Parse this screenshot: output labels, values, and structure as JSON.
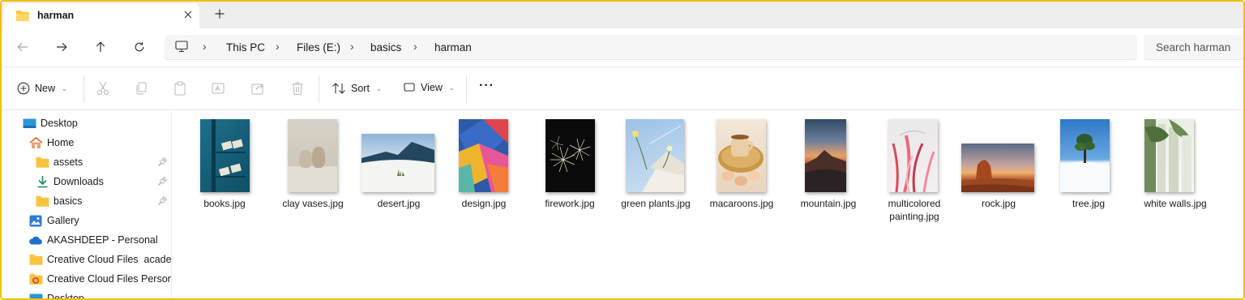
{
  "tab": {
    "title": "harman",
    "close_icon": "close-icon",
    "new_tab_icon": "plus-icon"
  },
  "breadcrumb": [
    "This PC",
    "Files (E:)",
    "basics",
    "harman"
  ],
  "search": {
    "placeholder": "Search harman"
  },
  "toolbar": {
    "new_label": "New",
    "sort_label": "Sort",
    "view_label": "View",
    "more_label": "···"
  },
  "sidebar": {
    "items": [
      {
        "label": "Desktop"
      },
      {
        "label": "Home"
      },
      {
        "label": "assets"
      },
      {
        "label": "Downloads"
      },
      {
        "label": "basics"
      },
      {
        "label": "Gallery"
      },
      {
        "label": "AKASHDEEP - Personal"
      },
      {
        "label": "Creative Cloud Files  academ"
      },
      {
        "label": "Creative Cloud Files Personal"
      },
      {
        "label": "Desktop"
      }
    ]
  },
  "files": [
    {
      "line1": "books.jpg",
      "line2": ""
    },
    {
      "line1": "clay vases.jpg",
      "line2": ""
    },
    {
      "line1": "desert.jpg",
      "line2": ""
    },
    {
      "line1": "design.jpg",
      "line2": ""
    },
    {
      "line1": "firework.jpg",
      "line2": ""
    },
    {
      "line1": "green plants.jpg",
      "line2": ""
    },
    {
      "line1": "macaroons.jpg",
      "line2": ""
    },
    {
      "line1": "mountain.jpg",
      "line2": ""
    },
    {
      "line1": "multicolored",
      "line2": "painting.jpg"
    },
    {
      "line1": "rock.jpg",
      "line2": ""
    },
    {
      "line1": "tree.jpg",
      "line2": ""
    },
    {
      "line1": "white walls.jpg",
      "line2": ""
    }
  ],
  "colors": {
    "accent": "#0067c0",
    "folder": "#f8c440",
    "frame": "#f0c000"
  }
}
